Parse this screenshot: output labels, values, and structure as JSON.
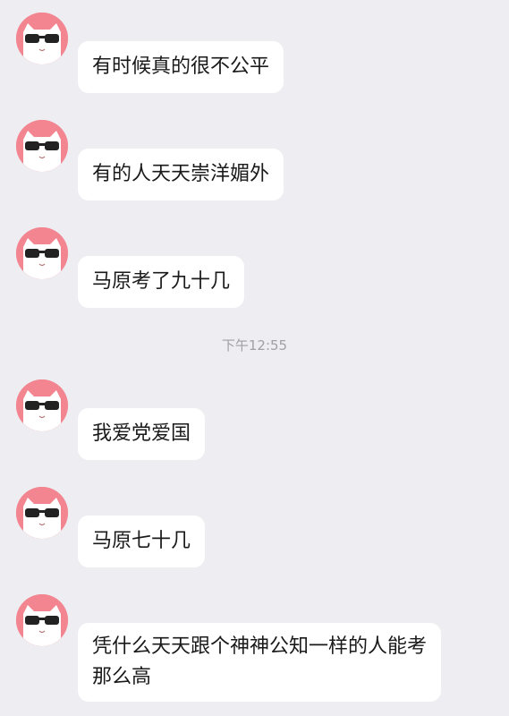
{
  "messages": [
    {
      "sender": "",
      "text": "有时候真的很不公平"
    },
    {
      "sender": "",
      "text": "有的人天天崇洋媚外"
    },
    {
      "sender": "",
      "text": "马原考了九十几"
    },
    {
      "sender": "",
      "text": "我爱党爱国"
    },
    {
      "sender": "",
      "text": "马原七十几"
    },
    {
      "sender": "",
      "text": "凭什么天天跟个神神公知一样的人能考那么高"
    }
  ],
  "timestamp": "下午12:55",
  "colors": {
    "background": "#ededf2",
    "bubble": "#ffffff",
    "avatar": "#f2858f",
    "timestamp": "#a0a0a5"
  },
  "icons": {
    "avatar": "cat-with-sunglasses-icon"
  }
}
